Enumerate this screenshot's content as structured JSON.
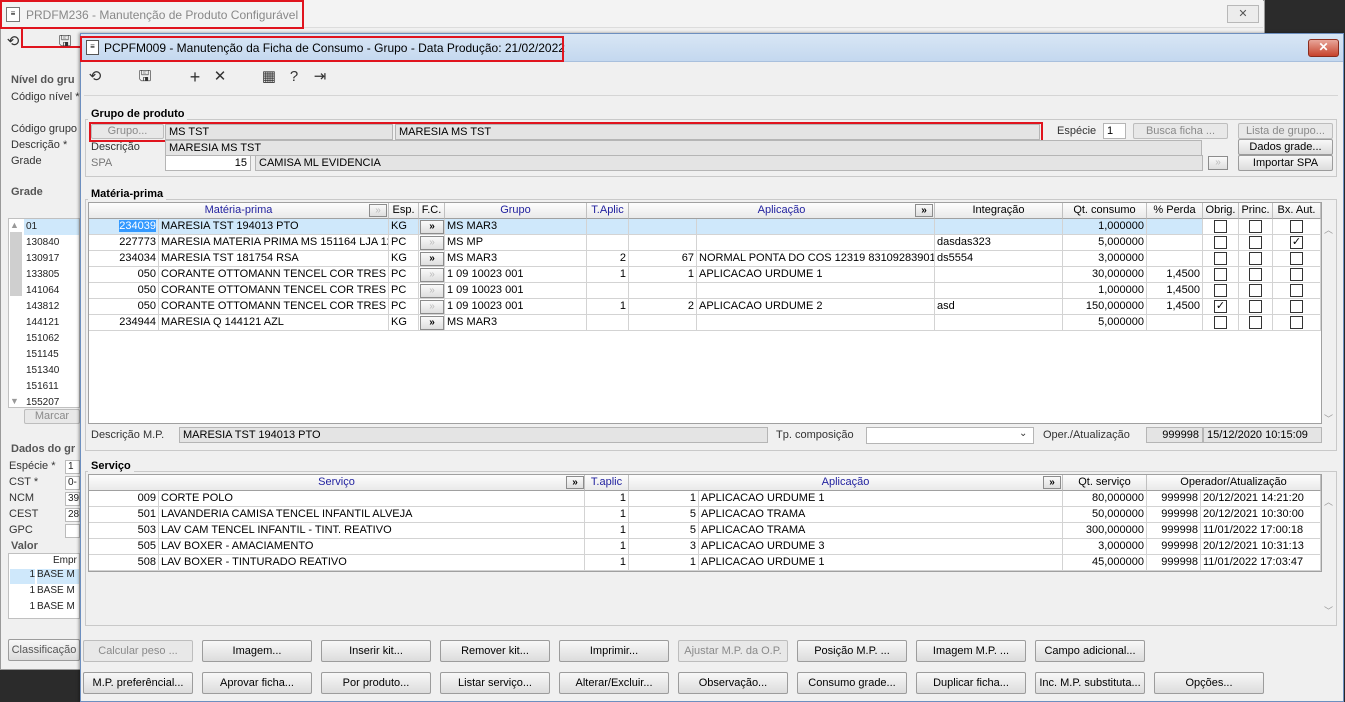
{
  "back_window": {
    "title": "PRDFM236 - Manutenção de Produto Configurável",
    "labels": {
      "nivel": "Nível do gru",
      "codigo_nivel": "Código nível *",
      "codigo_grupo": "Código grupo",
      "descricao": "Descrição *",
      "grade": "Grade",
      "grade_group": "Grade",
      "dados_group": "Dados do gr",
      "especie": "Espécie *",
      "cst": "CST *",
      "ncm": "NCM",
      "cest": "CEST",
      "gpc": "GPC",
      "valor": "Valor",
      "empr": "Empr",
      "marcar": "Marcar",
      "classificacao": "Classificação"
    },
    "grade_items": [
      "01",
      "130840",
      "130917",
      "133805",
      "141064",
      "143812",
      "144121",
      "151062",
      "151145",
      "151340",
      "151611",
      "155207"
    ],
    "dados_values": [
      "1",
      "0-",
      "39",
      "28"
    ],
    "valor_rows": [
      {
        "n": "1",
        "label": "BASE M"
      },
      {
        "n": "1",
        "label": "BASE M"
      },
      {
        "n": "1",
        "label": "BASE M"
      }
    ]
  },
  "window": {
    "title": "PCPFM009 - Manutenção da Ficha de Consumo - Grupo - Data Produção: 21/02/2022",
    "close": "✕"
  },
  "toolbar": {
    "icons": [
      "undo-icon",
      "save-icon",
      "add-icon",
      "delete-icon",
      "calendar-icon",
      "help-icon",
      "exit-icon"
    ]
  },
  "grupo_produto": {
    "title": "Grupo de produto",
    "grupo_button": "Grupo...",
    "grupo_code": "MS TST",
    "grupo_name": "MARESIA MS TST",
    "especie_label": "Espécie",
    "especie_value": "1",
    "busca_ficha": "Busca ficha ...",
    "lista_grupo": "Lista de grupo...",
    "dados_grade": "Dados grade...",
    "importar_spa": "Importar SPA",
    "descricao_label": "Descrição",
    "descricao_value": "MARESIA MS TST",
    "spa_label": "SPA",
    "spa_value": "15",
    "spa_desc": "CAMISA ML EVIDENCIA"
  },
  "materia_prima": {
    "title": "Matéria-prima",
    "headers": {
      "mp": "Matéria-prima",
      "esp": "Esp.",
      "fc": "F.C.",
      "grupo": "Grupo",
      "taplic": "T.Aplic",
      "aplicacao": "Aplicação",
      "integracao": "Integração",
      "qt": "Qt. consumo",
      "perda": "% Perda",
      "obrig": "Obrig.",
      "princ": "Princ.",
      "bx": "Bx. Aut."
    },
    "rows": [
      {
        "code": "234039",
        "desc": "MARESIA TST 194013 PTO",
        "esp": "KG",
        "fc": "»",
        "grupo": "MS MAR3",
        "taplic": "",
        "aplic_n": "",
        "aplic_desc": "",
        "integ": "",
        "qt": "1,000000",
        "perda": "",
        "obrig": false,
        "princ": false,
        "bx": false
      },
      {
        "code": "227773",
        "desc": "MARESIA MATERIA PRIMA MS 151164 LJA 12CM",
        "esp": "PC",
        "fc": "»",
        "grupo": "MS MP",
        "taplic": "",
        "aplic_n": "",
        "aplic_desc": "",
        "integ": "dasdas323",
        "qt": "5,000000",
        "perda": "",
        "obrig": false,
        "princ": false,
        "bx": true
      },
      {
        "code": "234034",
        "desc": "MARESIA TST 181754 RSA",
        "esp": "KG",
        "fc": "»",
        "grupo": "MS MAR3",
        "taplic": "2",
        "aplic_n": "67",
        "aplic_desc": "NORMAL PONTA DO COS 12319 83109283901 S",
        "integ": "ds5554",
        "qt": "3,000000",
        "perda": "",
        "obrig": false,
        "princ": false,
        "bx": false
      },
      {
        "code": "050",
        "desc": "CORANTE OTTOMANN TENCEL COR TRES 42",
        "esp": "PC",
        "fc": "»",
        "grupo": "1 09 10023 001",
        "taplic": "1",
        "aplic_n": "1",
        "aplic_desc": "APLICACAO URDUME 1",
        "integ": "",
        "qt": "30,000000",
        "perda": "1,4500",
        "obrig": false,
        "princ": false,
        "bx": false
      },
      {
        "code": "050",
        "desc": "CORANTE OTTOMANN TENCEL COR TRES 42",
        "esp": "PC",
        "fc": "»",
        "grupo": "1 09 10023 001",
        "taplic": "",
        "aplic_n": "",
        "aplic_desc": "",
        "integ": "",
        "qt": "1,000000",
        "perda": "1,4500",
        "obrig": false,
        "princ": false,
        "bx": false
      },
      {
        "code": "050",
        "desc": "CORANTE OTTOMANN TENCEL COR TRES 42",
        "esp": "PC",
        "fc": "»",
        "grupo": "1 09 10023 001",
        "taplic": "1",
        "aplic_n": "2",
        "aplic_desc": "APLICACAO URDUME 2",
        "integ": "asd",
        "qt": "150,000000",
        "perda": "1,4500",
        "obrig": true,
        "princ": false,
        "bx": false
      },
      {
        "code": "234944",
        "desc": "MARESIA Q 144121 AZL",
        "esp": "KG",
        "fc": "»",
        "grupo": "MS MAR3",
        "taplic": "",
        "aplic_n": "",
        "aplic_desc": "",
        "integ": "",
        "qt": "5,000000",
        "perda": "",
        "obrig": false,
        "princ": false,
        "bx": false
      }
    ],
    "fc_active": [
      true,
      false,
      true,
      false,
      false,
      false,
      true
    ],
    "descricao_mp_label": "Descrição M.P.",
    "descricao_mp_value": "MARESIA TST 194013 PTO",
    "tp_composicao_label": "Tp. composição",
    "oper_label": "Oper./Atualização",
    "oper_code": "999998",
    "oper_date": "15/12/2020 10:15:09"
  },
  "servico": {
    "title": "Serviço",
    "headers": {
      "servico": "Serviço",
      "taplic": "T.aplic",
      "aplicacao": "Aplicação",
      "qt": "Qt. serviço",
      "operador": "Operador/Atualização"
    },
    "rows": [
      {
        "code": "009",
        "desc": "CORTE POLO",
        "taplic": "1",
        "aplic_n": "1",
        "aplic_desc": "APLICACAO URDUME 1",
        "qt": "80,000000",
        "oper": "999998",
        "date": "20/12/2021 14:21:20"
      },
      {
        "code": "501",
        "desc": "LAVANDERIA CAMISA TENCEL INFANTIL ALVEJA",
        "taplic": "1",
        "aplic_n": "5",
        "aplic_desc": "APLICACAO TRAMA",
        "qt": "50,000000",
        "oper": "999998",
        "date": "20/12/2021 10:30:00"
      },
      {
        "code": "503",
        "desc": "LAV CAM TENCEL INFANTIL - TINT. REATIVO",
        "taplic": "1",
        "aplic_n": "5",
        "aplic_desc": "APLICACAO TRAMA",
        "qt": "300,000000",
        "oper": "999998",
        "date": "11/01/2022 17:00:18"
      },
      {
        "code": "505",
        "desc": "LAV BOXER - AMACIAMENTO",
        "taplic": "1",
        "aplic_n": "3",
        "aplic_desc": "APLICACAO URDUME 3",
        "qt": "3,000000",
        "oper": "999998",
        "date": "20/12/2021 10:31:13"
      },
      {
        "code": "508",
        "desc": "LAV BOXER - TINTURADO REATIVO",
        "taplic": "1",
        "aplic_n": "1",
        "aplic_desc": "APLICACAO URDUME 1",
        "qt": "45,000000",
        "oper": "999998",
        "date": "11/01/2022 17:03:47"
      }
    ]
  },
  "buttons_row1": [
    {
      "label": "Calcular peso ...",
      "enabled": false
    },
    {
      "label": "Imagem...",
      "enabled": true
    },
    {
      "label": "Inserir kit...",
      "enabled": true
    },
    {
      "label": "Remover kit...",
      "enabled": true
    },
    {
      "label": "Imprimir...",
      "enabled": true
    },
    {
      "label": "Ajustar M.P. da O.P.",
      "enabled": false
    },
    {
      "label": "Posição M.P. ...",
      "enabled": true
    },
    {
      "label": "Imagem M.P. ...",
      "enabled": true
    },
    {
      "label": "Campo adicional...",
      "enabled": true
    }
  ],
  "buttons_row2": [
    {
      "label": "M.P. preferêncial...",
      "enabled": true
    },
    {
      "label": "Aprovar ficha...",
      "enabled": true
    },
    {
      "label": "Por produto...",
      "enabled": true
    },
    {
      "label": "Listar serviço...",
      "enabled": true
    },
    {
      "label": "Alterar/Excluir...",
      "enabled": true
    },
    {
      "label": "Observação...",
      "enabled": true
    },
    {
      "label": "Consumo grade...",
      "enabled": true
    },
    {
      "label": "Duplicar ficha...",
      "enabled": true
    },
    {
      "label": "Inc. M.P. substituta...",
      "enabled": true
    },
    {
      "label": "Opções...",
      "enabled": true
    }
  ]
}
